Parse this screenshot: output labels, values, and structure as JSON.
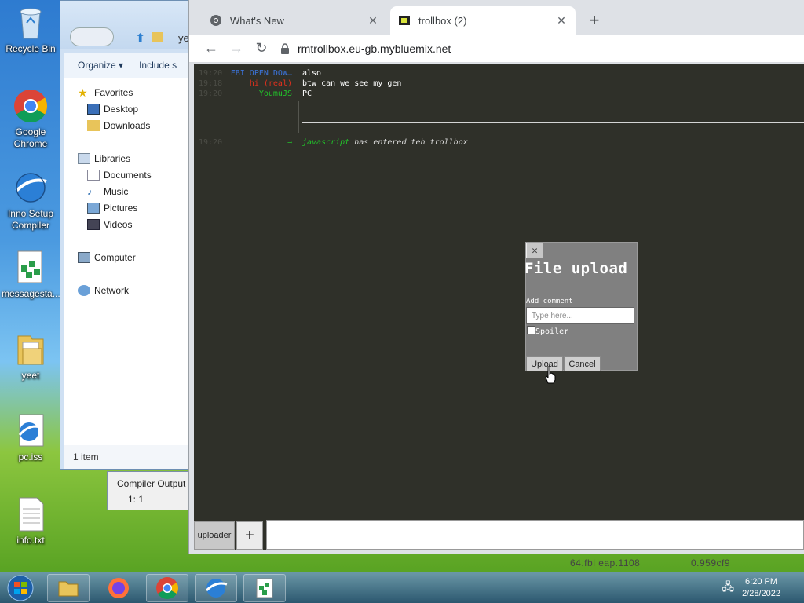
{
  "desktop": {
    "icons": [
      {
        "label": "Recycle Bin",
        "icon": "recycle-bin-icon"
      },
      {
        "label": "Google Chrome",
        "icon": "chrome-icon"
      },
      {
        "label": "Inno Setup Compiler",
        "icon": "inno-setup-icon"
      },
      {
        "label": "messagesta...",
        "icon": "script-file-icon"
      },
      {
        "label": "yeet",
        "icon": "folder-icon"
      },
      {
        "label": "pc.iss",
        "icon": "iss-file-icon"
      },
      {
        "label": "info.txt",
        "icon": "text-file-icon"
      }
    ]
  },
  "explorer": {
    "path_fragment": "ye",
    "toolbar": {
      "organize": "Organize",
      "include": "Include s"
    },
    "nav": {
      "favorites": "Favorites",
      "desktop": "Desktop",
      "downloads": "Downloads",
      "libraries": "Libraries",
      "documents": "Documents",
      "music": "Music",
      "pictures": "Pictures",
      "videos": "Videos",
      "computer": "Computer",
      "network": "Network"
    },
    "status": "1 item"
  },
  "compiler": {
    "title": "Compiler Output",
    "value": "1:  1"
  },
  "browser": {
    "tabs": [
      {
        "title": "What's New",
        "icon": "chrome-icon",
        "active": false
      },
      {
        "title": "trollbox (2)",
        "icon": "trollbox-icon",
        "active": true
      }
    ],
    "url": "rmtrollbox.eu-gb.mybluemix.net"
  },
  "chat": {
    "messages": [
      {
        "time": "19:20",
        "nick": "FBI OPEN DOW…",
        "nick_color": "#3b73d9",
        "text": "also"
      },
      {
        "time": "19:18",
        "nick": "hi (real)",
        "nick_color": "#e0301e",
        "text": "btw can we see my gen"
      },
      {
        "time": "19:20",
        "nick": "YoumuJS",
        "nick_color": "#22c02a",
        "text": "PC"
      }
    ],
    "system": {
      "time": "19:20",
      "arrow": "→",
      "user": "javascript",
      "text": "has entered teh trollbox"
    },
    "room_tab": "uploader",
    "room_add": "+"
  },
  "dialog": {
    "close": "✕",
    "title": "File upload",
    "comment_label": "Add comment",
    "comment_placeholder": "Type here...",
    "spoiler_label": "Spoiler",
    "upload_button": "Upload",
    "cancel_button": "Cancel"
  },
  "background_text": "64.fbl  eap.1108",
  "background_text2": "0.959cf9",
  "taskbar": {
    "items": [
      "explorer-icon",
      "firefox-icon",
      "chrome-icon",
      "inno-setup-icon",
      "script-file-icon"
    ],
    "time": "6:20 PM",
    "date": "2/28/2022"
  }
}
